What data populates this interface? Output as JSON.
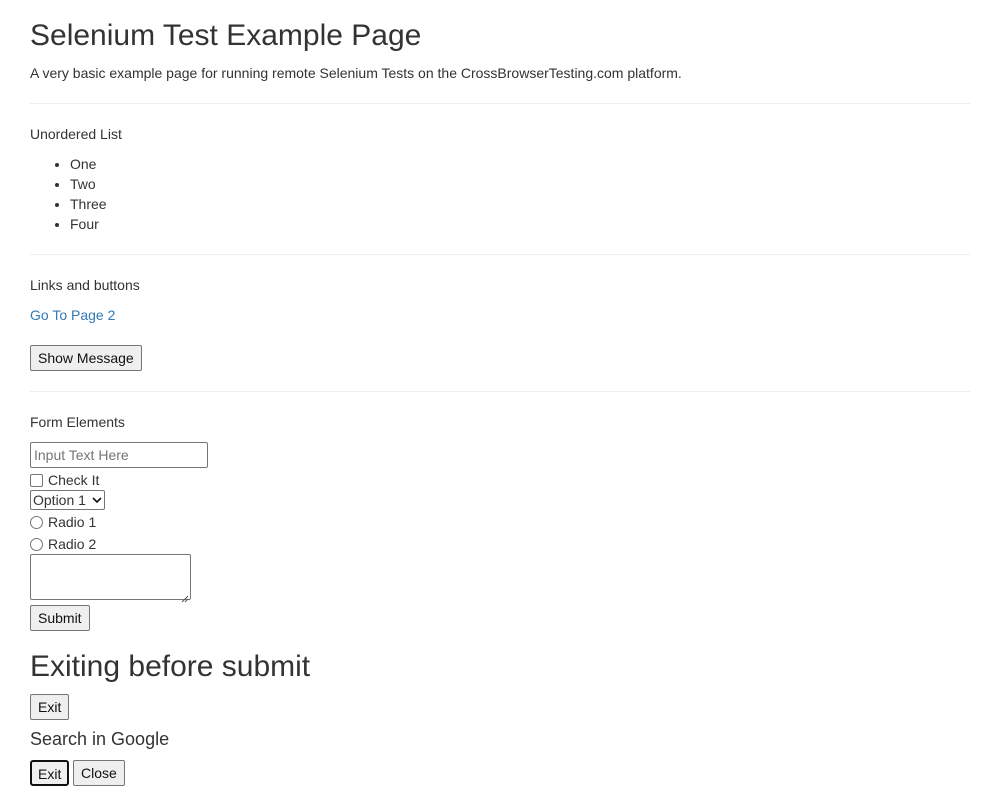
{
  "header": {
    "title": "Selenium Test Example Page",
    "subtitle": "A very basic example page for running remote Selenium Tests on the CrossBrowserTesting.com platform."
  },
  "unordered_list": {
    "label": "Unordered List",
    "items": [
      "One",
      "Two",
      "Three",
      "Four"
    ]
  },
  "links_buttons": {
    "label": "Links and buttons",
    "link_text": "Go To Page 2",
    "button_label": "Show Message"
  },
  "form": {
    "label": "Form Elements",
    "text_input": {
      "value": "",
      "placeholder": "Input Text Here"
    },
    "checkbox_label": "Check It",
    "select_value": "Option 1",
    "radio_1_label": "Radio 1",
    "radio_2_label": "Radio 2",
    "textarea_value": "",
    "submit_label": "Submit"
  },
  "exiting": {
    "heading": "Exiting before submit",
    "exit_label": "Exit"
  },
  "search": {
    "heading": "Search in Google",
    "exit_label": "Exit",
    "close_label": "Close"
  },
  "colors": {
    "text": "#333333",
    "link": "#337ab7",
    "divider": "#eeeeee",
    "button_bg": "#efefef",
    "control_border": "#767676"
  },
  "icons": {
    "select_arrow": "chevron-down-icon",
    "textarea_grip": "resize-grip-icon"
  }
}
